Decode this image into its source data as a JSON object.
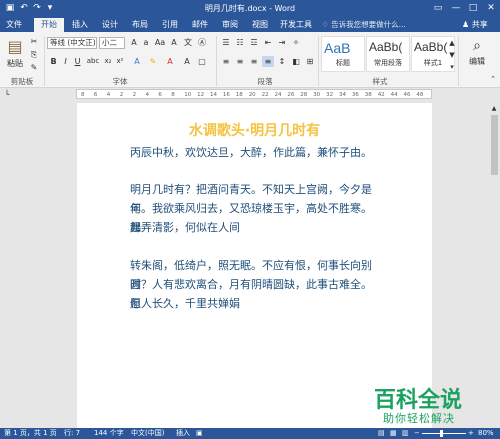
{
  "titlebar": {
    "title": "明月几时有.docx - Word",
    "quick_access": [
      "save-icon",
      "undo-icon",
      "redo-icon",
      "customize-icon"
    ],
    "restore_icon": "▭",
    "minimize": "—",
    "maximize": "□",
    "close": "✕"
  },
  "tabs": [
    "文件",
    "开始",
    "插入",
    "设计",
    "布局",
    "引用",
    "邮件",
    "审阅",
    "视图",
    "开发工具"
  ],
  "active_tab": "开始",
  "tellme": "告诉我您想要做什么...",
  "share": "共享",
  "ribbon": {
    "paste_label": "粘贴",
    "clipboard_label": "剪贴板",
    "font_name": "等线 (中文正)",
    "font_size": "小二",
    "font_group_label": "字体",
    "paragraph_group_label": "段落",
    "styles_group_label": "样式",
    "edit_label": "编辑",
    "styles": [
      {
        "preview": "AaB",
        "name": "标题"
      },
      {
        "preview": "AaBb(",
        "name": "常用段落"
      },
      {
        "preview": "AaBb(",
        "name": "样式1"
      }
    ],
    "bold": "B",
    "italic": "I",
    "underline": "U"
  },
  "ruler_ticks": [
    "8",
    "6",
    "4",
    "2",
    "2",
    "4",
    "6",
    "8",
    "10",
    "12",
    "14",
    "16",
    "18",
    "20",
    "22",
    "24",
    "26",
    "28",
    "30",
    "32",
    "34",
    "36",
    "38",
    "42",
    "44",
    "46",
    "48"
  ],
  "document": {
    "title": "水调歌头·明月几时有",
    "p1": "丙辰中秋，欢饮达旦，大醉，作此篇，兼怀子由。",
    "p2_l1": "明月几时有？把酒问青天。不知天上宫阙，今夕是何",
    "p2_l2": "年。我欲乘风归去，又恐琼楼玉宇，高处不胜寒。起",
    "p2_l3": "舞弄清影，何似在人间",
    "p3_l1": "转朱阁，低绮户，照无眠。不应有恨，何事长向别时",
    "p3_l2": "圆？人有悲欢离合，月有阴晴圆缺，此事古难全。但",
    "p3_l3": "愿人长久，千里共婵娟"
  },
  "watermark": {
    "main": "百科全说",
    "sub": "助你轻松解决"
  },
  "statusbar": {
    "page": "第 1 页，共 1 页",
    "line": "行: 7",
    "words": "144 个字",
    "language": "中文(中国)",
    "mode": "插入",
    "zoom": "80%"
  },
  "colors": {
    "word_blue": "#2b579a",
    "title_gold": "#f5c342",
    "body_text": "#1f4e79",
    "watermark_green": "#1aa260"
  }
}
